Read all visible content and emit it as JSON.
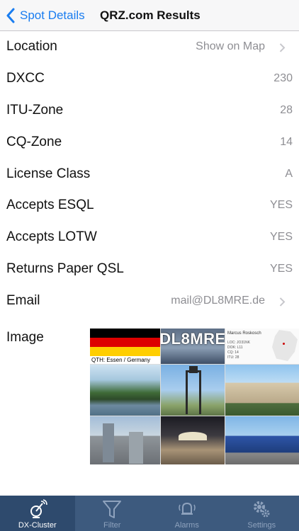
{
  "nav": {
    "back_label": "Spot Details",
    "title": "QRZ.com Results"
  },
  "rows": [
    {
      "label": "Location",
      "value": "Show on Map",
      "link": true
    },
    {
      "label": "DXCC",
      "value": "230",
      "link": false
    },
    {
      "label": "ITU-Zone",
      "value": "28",
      "link": false
    },
    {
      "label": "CQ-Zone",
      "value": "14",
      "link": false
    },
    {
      "label": "License Class",
      "value": "A",
      "link": false
    },
    {
      "label": "Accepts ESQL",
      "value": "YES",
      "link": false
    },
    {
      "label": "Accepts LOTW",
      "value": "YES",
      "link": false
    },
    {
      "label": "Returns Paper QSL",
      "value": "YES",
      "link": false
    },
    {
      "label": "Email",
      "value": "mail@DL8MRE.de",
      "link": true
    }
  ],
  "image_section": {
    "label": "Image",
    "callsign": "DL8MRE",
    "qth_text": "QTH: Essen / Germany",
    "card_name": "Marcus Roskosch",
    "card_lines": [
      "LOC: JO31NK",
      "DOK: L11",
      "CQ: 14",
      "ITU: 28"
    ]
  },
  "tabbar": {
    "tabs": [
      {
        "label": "DX-Cluster",
        "icon": "antenna-icon",
        "active": true
      },
      {
        "label": "Filter",
        "icon": "funnel-icon",
        "active": false
      },
      {
        "label": "Alarms",
        "icon": "bell-icon",
        "active": false
      },
      {
        "label": "Settings",
        "icon": "gears-icon",
        "active": false
      }
    ]
  },
  "colors": {
    "accent": "#1a7df0",
    "tabbar_bg": "#3d5a7e",
    "value_gray": "#8e8e93"
  }
}
